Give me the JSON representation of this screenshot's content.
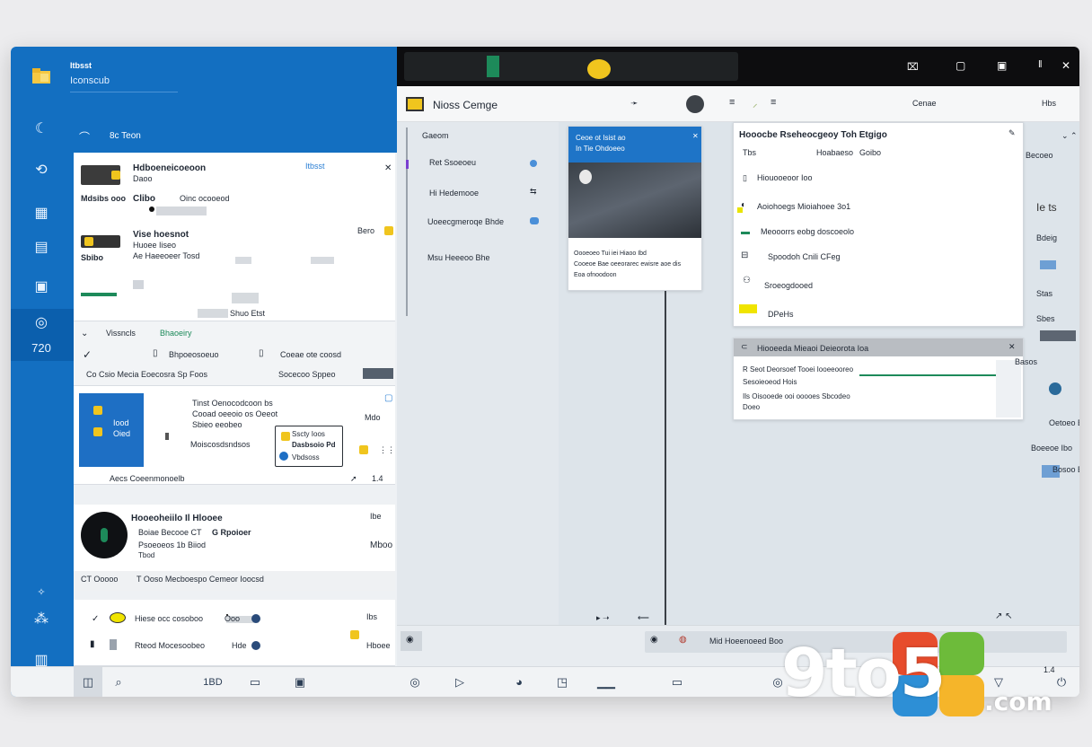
{
  "left_header": {
    "small_title": "Itbsst",
    "subtitle": "Iconscub",
    "filter_label": "8c Teon"
  },
  "rail": {
    "items": [
      "shell-icon",
      "history-icon",
      "chart-icon",
      "calendar-icon",
      "notes-icon",
      "pin-icon",
      "grid-icon"
    ],
    "selected_label": "720"
  },
  "left_cards": [
    {
      "title": "Hdboeneicoeoon",
      "title2": "Daoo",
      "side": "Itbsst",
      "meta_left": "Mdsibs ooo",
      "meta_mid": "Clibo",
      "meta_right": "Oinc ocooeod"
    },
    {
      "title": "Vise hoesnot",
      "right_meta": "Bero",
      "line1": "Huoee Iiseo",
      "line2": "Ae Haeeoeer Tosd",
      "line3": "Sbibo",
      "footer": "Shuo Etst"
    }
  ],
  "left_filter_row": {
    "left": "Vissncls",
    "mid": "Bhaoeiry",
    "item1": "Bhpoeosoeuo",
    "item2": "Coeae ote coosd",
    "item3": "Co Csio Mecia Eoecosra Sp Foos",
    "item4": "Socecoo Sppeo"
  },
  "left_promo": {
    "tile_line1": "Iood",
    "tile_line2": "Oied",
    "text1": "Tinst Oenocodcoon bs",
    "text2": "Cooad oeeoio os Oeeot",
    "text3": "Sbieo eeobeo",
    "text4": "Moiscosdsndsos",
    "popup1": "Sscty Ioos",
    "popup2": "Dasbsoio Pd",
    "popup3": "Vbdsoss",
    "right_meta": "Mdo",
    "footer": "Aecs Coeenmonoelb",
    "footer_right": "1.4"
  },
  "left_contact": {
    "name": "Hooeoheiilo Il Hlooee",
    "line1": "Boiae Becooe CT",
    "line1b": "G Rpoioer",
    "line2": "Psoeoeos 1b Biiod",
    "line3": "Tbod",
    "right1": "Ibe",
    "right2": "Mboo",
    "footer1": "CT Ooooo",
    "footer2": "T Ooso Mecboespo Cemeor Ioocsd"
  },
  "left_bottom_card": {
    "row1": "Hiese occ cosoboo",
    "row1b": "Ooo",
    "row2": "Rteod Mocesoobeo",
    "row2b": "Hde",
    "right1": "Ibs",
    "right2": "Hboee"
  },
  "top_bar": {
    "title": "Nioss Cemge",
    "right_label": "Cenae",
    "far_right": "Hbs"
  },
  "nav": {
    "header": "Gaeom",
    "items": [
      "Ret Ssoeoeu",
      "Hi Hedemooe",
      "Uoeecgmeroqe Bhde",
      "Msu Heeeoo Bhe"
    ]
  },
  "article": {
    "head1": "Ceoe ot Isist ao",
    "head2": "In Tie Ohdoeeo",
    "body1": "Oooeoeo Tui iei Hiaoo Ibd",
    "body2": "Cooeoe Bae oeeorarec ewisre aoe dis",
    "body3": "Eoa ofnoodoon"
  },
  "detail": {
    "title": "Hooocbe Rseheocgeoy Toh Etgigo",
    "tabs": [
      "Tbs",
      "Hoabaeso",
      "Goibo"
    ],
    "items": [
      "Hiouooeoor Ioo",
      "Aoiohoegs Mioiahoee 3o1",
      "Meooorrs eobg doscoeolo",
      "Spoodoh Cnili CFeg",
      "Sroeogdooed",
      "DPeHs"
    ]
  },
  "detail2": {
    "title": "Hiooeeda Mieaoi Deieorota Ioa",
    "row1": "R Seot Deorsoef Tooei Iooeeooreo",
    "row2": "Sesoieoeod Hois",
    "row3": "Ils Oisooede ooi ooooes Sbcodeo",
    "row4": "Doeo"
  },
  "far_right": {
    "items": [
      "Becoeo",
      "Ie ts",
      "Bdeig",
      "Stas",
      "Sbes",
      "Basos",
      "Oetoeo Boe",
      "Boeeoe Ibo",
      "Bosoo Boo"
    ]
  },
  "bottom_right": {
    "tab_label": "Mid Hoeenoeed Boo",
    "right_meta": "1.4"
  },
  "taskbar": {
    "icons": [
      "system-icon",
      "search-icon",
      "files-icon",
      "store-icon",
      "mail-icon",
      "globe-icon",
      "terminal-icon",
      "chat-icon",
      "clock-icon",
      "window-icon"
    ],
    "left_labels": [
      "1BD"
    ]
  },
  "watermark": {
    "text_main": "9to5",
    "text_sub": ".com"
  },
  "colors": {
    "brand_blue": "#136fc1",
    "dark_top": "#0d0d0f",
    "accent_yellow": "#f0c51e",
    "accent_green": "#1d8a5a"
  }
}
